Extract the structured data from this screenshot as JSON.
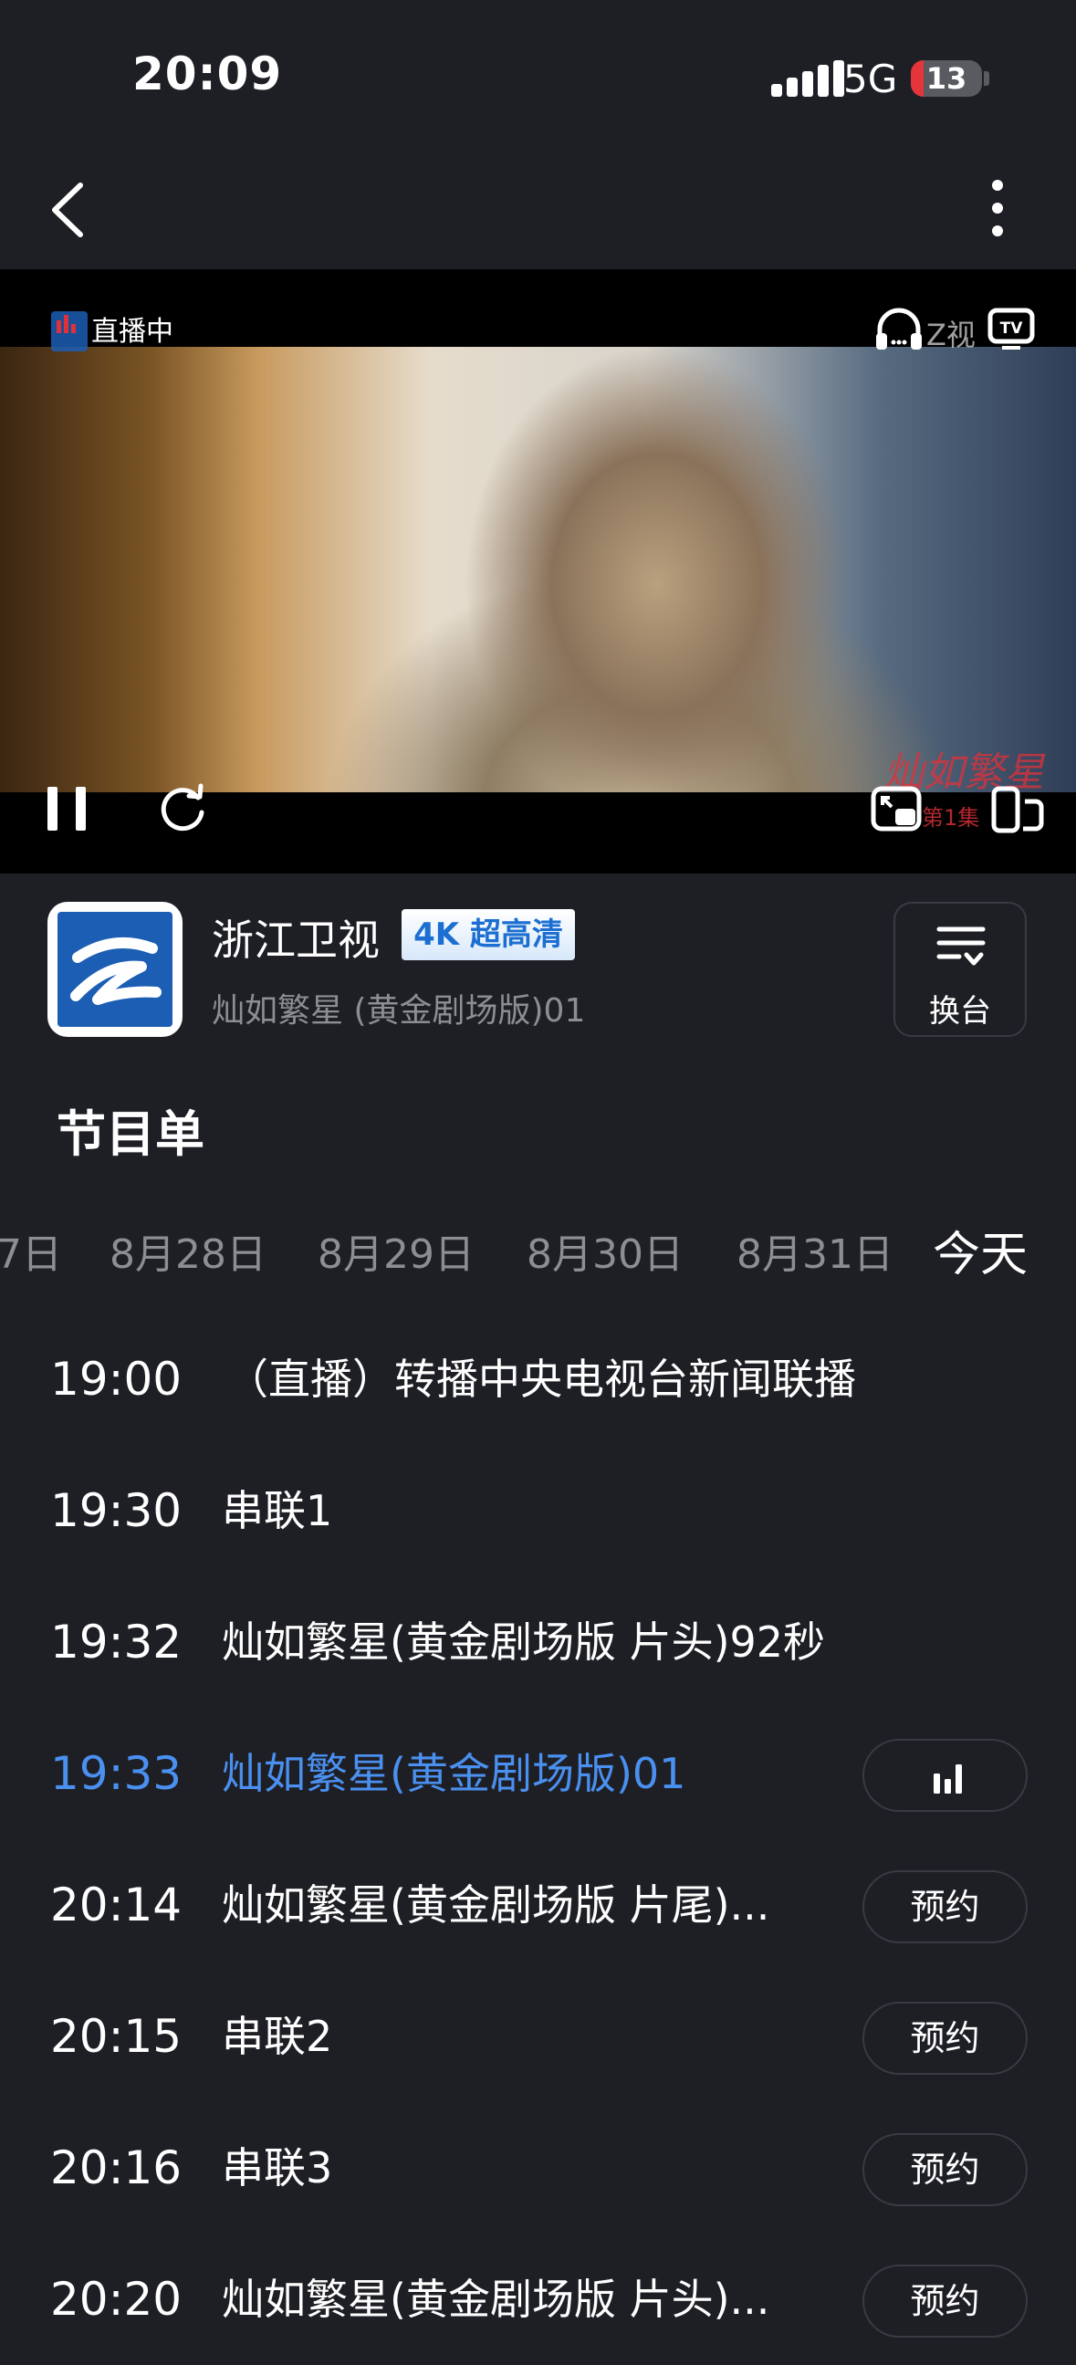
{
  "status_bar": {
    "time": "20:09",
    "network": "5G",
    "battery": "13"
  },
  "player": {
    "live_label": "直播中",
    "channel_watermark": "Z视",
    "overlay_title": "灿如繁星",
    "overlay_episode": "第1集"
  },
  "channel": {
    "name": "浙江卫视",
    "quality_badge": "4K 超高清",
    "current_program": "灿如繁星 (黄金剧场版)01",
    "switch_label": "换台"
  },
  "guide": {
    "title": "节目单",
    "dates": [
      "7日",
      "8月28日",
      "8月29日",
      "8月30日",
      "8月31日",
      "今天"
    ],
    "active_date": "今天",
    "programs": [
      {
        "time": "19:00",
        "title": "（直播）转播中央电视台新闻联播",
        "action": ""
      },
      {
        "time": "19:30",
        "title": "串联1",
        "action": ""
      },
      {
        "time": "19:32",
        "title": "灿如繁星(黄金剧场版 片头)92秒",
        "action": ""
      },
      {
        "time": "19:33",
        "title": "灿如繁星(黄金剧场版)01",
        "action": "playing",
        "current": true
      },
      {
        "time": "20:14",
        "title": "灿如繁星(黄金剧场版 片尾)...",
        "action": "预约"
      },
      {
        "time": "20:15",
        "title": "串联2",
        "action": "预约"
      },
      {
        "time": "20:16",
        "title": "串联3",
        "action": "预约"
      },
      {
        "time": "20:20",
        "title": "灿如繁星(黄金剧场版 片头)...",
        "action": "预约"
      }
    ]
  },
  "colors": {
    "background": "#1e1f25",
    "accent": "#4a90f0",
    "muted_text": "#8d8e93"
  }
}
